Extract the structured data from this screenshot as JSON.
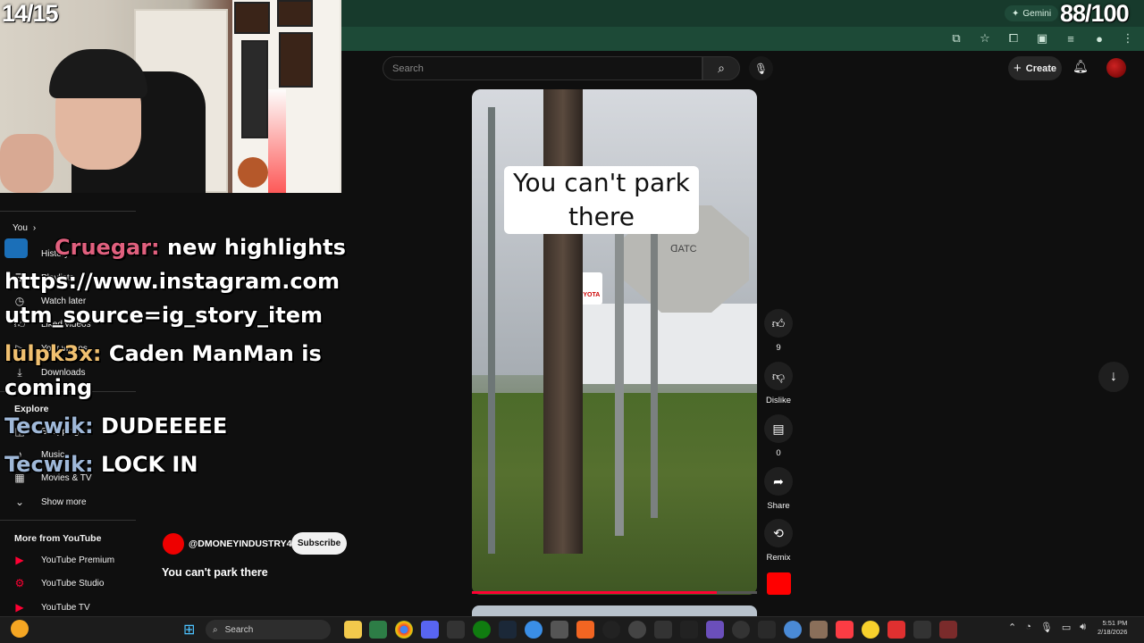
{
  "stream_overlay": {
    "left_counter": "14/15",
    "right_counter": "88/100"
  },
  "browser": {
    "gemini_label": "Gemini"
  },
  "header": {
    "search_placeholder": "Search",
    "create_label": "Create"
  },
  "sidebar": {
    "you_label": "You",
    "items": [
      {
        "label": "History",
        "icon": "history-icon"
      },
      {
        "label": "Playlists",
        "icon": "playlist-icon"
      },
      {
        "label": "Watch later",
        "icon": "clock-icon"
      },
      {
        "label": "Liked videos",
        "icon": "thumbs-up-icon"
      },
      {
        "label": "Your videos",
        "icon": "play-icon"
      },
      {
        "label": "Downloads",
        "icon": "download-icon"
      }
    ],
    "explore_heading": "Explore",
    "explore_items": [
      {
        "label": "Shopping",
        "icon": "bag-icon"
      },
      {
        "label": "Music",
        "icon": "music-note-icon"
      },
      {
        "label": "Movies & TV",
        "icon": "film-icon"
      },
      {
        "label": "Show more",
        "icon": "chevron-down-icon"
      }
    ],
    "more_heading": "More from YouTube",
    "more_items": [
      {
        "label": "YouTube Premium"
      },
      {
        "label": "YouTube Studio"
      },
      {
        "label": "YouTube TV"
      }
    ]
  },
  "chat": [
    {
      "user": "Cruegar:",
      "user_color": "#e0607e",
      "text": "new highlights"
    },
    {
      "user": "",
      "user_color": "#ffffff",
      "text": "https://www.instagram.com"
    },
    {
      "user": "",
      "user_color": "#ffffff",
      "text": "utm_source=ig_story_item"
    },
    {
      "user": "lulpk3x:",
      "user_color": "#f0c070",
      "text": "Caden ManMan is coming"
    },
    {
      "user": "Tecwik:",
      "user_color": "#9fb8d8",
      "text": "DUDEEEEE"
    },
    {
      "user": "Tecwik:",
      "user_color": "#9fb8d8",
      "text": "LOCK IN"
    }
  ],
  "video": {
    "caption": "You can't park there",
    "progress": 0.86,
    "sign_text": "ᗡATC",
    "dealer_logo": "TOYOTA"
  },
  "actions": {
    "likes": "9",
    "dislike_label": "Dislike",
    "comments": "0",
    "share_label": "Share",
    "remix_label": "Remix"
  },
  "channel": {
    "name": "@DMONEYINDUSTRY4",
    "subscribe_label": "Subscribe",
    "video_title": "You can't park there"
  },
  "taskbar": {
    "search_label": "Search",
    "clock_time": "5:51 PM",
    "clock_date": "2/18/2026"
  },
  "colors": {
    "youtube_red": "#ff0033",
    "browser_chrome": "#173a2c"
  }
}
